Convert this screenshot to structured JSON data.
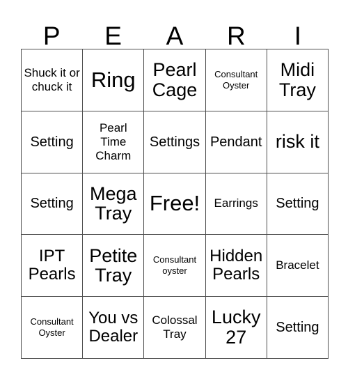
{
  "card": {
    "title_letters": [
      "P",
      "E",
      "A",
      "R",
      "I"
    ],
    "columns": 5,
    "rows": 5,
    "border_color": "#4d4d4d",
    "background_color": "#ffffff",
    "text_color": "#000000",
    "free_space": {
      "label": "Free!",
      "row": 3,
      "column": 3
    },
    "cells": [
      {
        "label": "Shuck it or chuck it",
        "size": "sm"
      },
      {
        "label": "Ring",
        "size": "xxl"
      },
      {
        "label": "Pearl Cage",
        "size": "xl"
      },
      {
        "label": "Consultant Oyster",
        "size": "xs"
      },
      {
        "label": "Midi Tray",
        "size": "xl"
      },
      {
        "label": "Setting",
        "size": "md"
      },
      {
        "label": "Pearl Time Charm",
        "size": "sm"
      },
      {
        "label": "Settings",
        "size": "md"
      },
      {
        "label": "Pendant",
        "size": "md"
      },
      {
        "label": "risk it",
        "size": "xl"
      },
      {
        "label": "Setting",
        "size": "md"
      },
      {
        "label": "Mega Tray",
        "size": "xl"
      },
      {
        "label": "Free!",
        "size": "xxl"
      },
      {
        "label": "Earrings",
        "size": "sm"
      },
      {
        "label": "Setting",
        "size": "md"
      },
      {
        "label": "IPT Pearls",
        "size": "lg"
      },
      {
        "label": "Petite Tray",
        "size": "xl"
      },
      {
        "label": "Consultant oyster",
        "size": "xs"
      },
      {
        "label": "Hidden Pearls",
        "size": "lg"
      },
      {
        "label": "Bracelet",
        "size": "sm"
      },
      {
        "label": "Consultant Oyster",
        "size": "xs"
      },
      {
        "label": "You vs Dealer",
        "size": "lg"
      },
      {
        "label": "Colossal Tray",
        "size": "sm"
      },
      {
        "label": "Lucky 27",
        "size": "xl"
      },
      {
        "label": "Setting",
        "size": "md"
      }
    ]
  }
}
